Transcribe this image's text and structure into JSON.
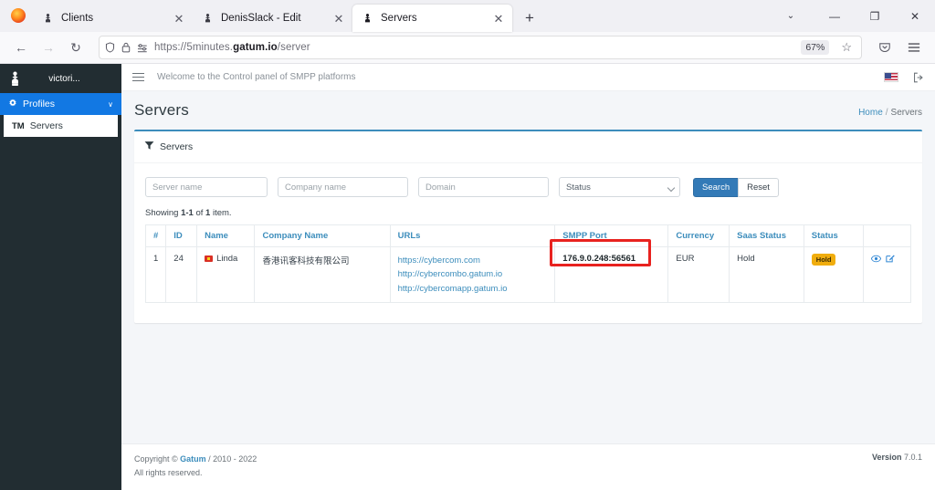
{
  "browser": {
    "tabs": [
      {
        "label": "Clients",
        "active": false
      },
      {
        "label": "DenisSlack - Edit",
        "active": false
      },
      {
        "label": "Servers",
        "active": true
      }
    ],
    "newtab_label": "+",
    "close_label": "✕",
    "back_label": "←",
    "forward_label": "→",
    "reload_label": "↻",
    "url_prefix": "https://5minutes.",
    "url_domain": "gatum.io",
    "url_suffix": "/server",
    "zoom_level": "67%",
    "star_label": "☆",
    "window": {
      "chevron": "⌄",
      "minimize": "—",
      "maximize": "❐",
      "close": "✕"
    }
  },
  "sidebar": {
    "username": "victori...",
    "items": [
      {
        "label": "Profiles",
        "icon": "gear-icon",
        "active": true,
        "chevron": "∨"
      }
    ],
    "subitems": [
      {
        "prefix": "TM",
        "label": "Servers"
      }
    ]
  },
  "appbar": {
    "welcome": "Welcome to the Control panel of SMPP platforms",
    "language_icon": "us-flag-icon",
    "logout_icon": "logout-icon"
  },
  "page": {
    "title": "Servers",
    "breadcrumb": {
      "home": "Home",
      "separator": "/",
      "current": "Servers"
    }
  },
  "panel": {
    "title": "Servers",
    "icon": "servers-icon"
  },
  "filters": {
    "server_name_placeholder": "Server name",
    "company_name_placeholder": "Company name",
    "domain_placeholder": "Domain",
    "status_selected": "Status",
    "status_options": [
      "Status"
    ],
    "search_label": "Search",
    "reset_label": "Reset"
  },
  "results": {
    "showing_prefix": "Showing ",
    "showing_range": "1-1",
    "showing_mid": " of ",
    "showing_count": "1",
    "showing_suffix": " item.",
    "columns": [
      "#",
      "ID",
      "Name",
      "Company Name",
      "URLs",
      "SMPP Port",
      "Currency",
      "Saas Status",
      "Status",
      ""
    ],
    "rows": [
      {
        "num": "1",
        "id": "24",
        "name": "Linda",
        "name_flag": "cn-flag-icon",
        "company": "香港讯客科技有限公司",
        "urls": [
          "https://cybercom.com",
          "http://cybercombo.gatum.io",
          "http://cybercomapp.gatum.io"
        ],
        "smpp_port": "176.9.0.248:56561",
        "currency": "EUR",
        "saas_status": "Hold",
        "status_badge": "Hold",
        "actions": [
          "view-icon",
          "edit-icon"
        ]
      }
    ]
  },
  "highlight": {
    "color": "#e8221f",
    "target": "smpp-port-cell"
  },
  "footer": {
    "copyright_prefix": "Copyright © ",
    "copyright_link": "Gatum",
    "copyright_years": " / 2010 - 2022",
    "rights": "All rights reserved.",
    "version_label": "Version",
    "version_value": "7.0.1"
  }
}
